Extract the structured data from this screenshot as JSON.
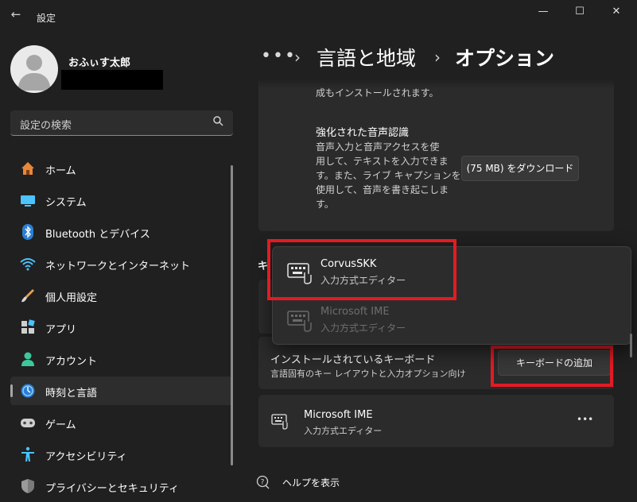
{
  "window": {
    "back_icon": "back-arrow-icon",
    "title": "設定",
    "minimize": "—",
    "maximize": "☐",
    "close": "✕"
  },
  "user": {
    "name": "おふぃす太郎"
  },
  "search": {
    "placeholder": "設定の検索",
    "icon": "search-icon"
  },
  "sidebar": {
    "items": [
      {
        "label": "ホーム",
        "icon": "home-icon"
      },
      {
        "label": "システム",
        "icon": "system-icon"
      },
      {
        "label": "Bluetooth とデバイス",
        "icon": "bluetooth-icon"
      },
      {
        "label": "ネットワークとインターネット",
        "icon": "network-icon"
      },
      {
        "label": "個人用設定",
        "icon": "personalization-icon"
      },
      {
        "label": "アプリ",
        "icon": "apps-icon"
      },
      {
        "label": "アカウント",
        "icon": "account-icon"
      },
      {
        "label": "時刻と言語",
        "icon": "time-language-icon",
        "active": true
      },
      {
        "label": "ゲーム",
        "icon": "gaming-icon"
      },
      {
        "label": "アクセシビリティ",
        "icon": "accessibility-icon"
      },
      {
        "label": "プライバシーとセキュリティ",
        "icon": "privacy-icon"
      }
    ]
  },
  "breadcrumb": {
    "dots": "•••",
    "sep": "›",
    "parent": "言語と地域",
    "current": "オプション"
  },
  "speech_card": {
    "top_text_partial": "成もインストールされます。",
    "title": "強化された音声認識",
    "description": [
      "音声入力と音声アクセスを使",
      "用して、テキストを入力できま",
      "す。また、ライブ キャプションを",
      "使用して、音声を書き起こしま",
      "す。"
    ],
    "download_button": "(75 MB) をダウンロード"
  },
  "keyboard_section": {
    "heading_partial": "キ",
    "installed_title": "インストールされているキーボード",
    "installed_sub": "言語固有のキー レイアウトと入力オプション向け",
    "add_button": "キーボードの追加"
  },
  "popup": {
    "items": [
      {
        "title": "CorvusSKK",
        "sub": "入力方式エディター",
        "enabled": true
      },
      {
        "title": "Microsoft IME",
        "sub": "入力方式エディター",
        "enabled": false
      }
    ]
  },
  "installed_keyboards": [
    {
      "title": "Microsoft IME",
      "sub": "入力方式エディター",
      "more": "•••"
    }
  ],
  "help": {
    "label": "ヘルプを表示"
  },
  "colors": {
    "background": "#202020",
    "card": "#2b2b2b",
    "highlight": "#e31b23",
    "accent": "#4cc2ff"
  }
}
